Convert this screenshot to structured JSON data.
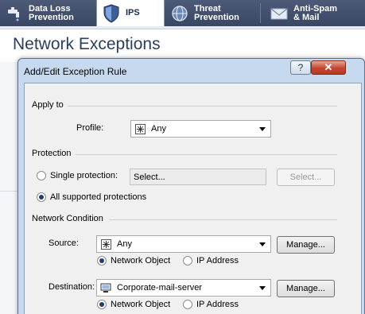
{
  "tabs": [
    {
      "line1": "Data Loss",
      "line2": "Prevention",
      "icon": "faucet-icon",
      "active": false
    },
    {
      "line1": "IPS",
      "line2": "",
      "icon": "shield-icon",
      "active": true
    },
    {
      "line1": "Threat",
      "line2": "Prevention",
      "icon": "globe-icon",
      "active": false
    },
    {
      "line1": "Anti-Spam",
      "line2": "& Mail",
      "icon": "envelope-icon",
      "active": false
    }
  ],
  "page": {
    "title": "Network Exceptions"
  },
  "dialog": {
    "title": "Add/Edit Exception Rule",
    "help_label": "?",
    "close_label": "✕",
    "apply_to": {
      "section_label": "Apply to",
      "profile_label": "Profile:",
      "profile_value": "Any"
    },
    "protection": {
      "section_label": "Protection",
      "single_label": "Single protection:",
      "single_value": "Select...",
      "select_button": "Select...",
      "all_label": "All supported protections",
      "selected": "all"
    },
    "network_condition": {
      "section_label": "Network Condition",
      "source_label": "Source:",
      "source_value": "Any",
      "source_manage": "Manage...",
      "source_radio_object": "Network Object",
      "source_radio_ip": "IP Address",
      "destination_label": "Destination:",
      "destination_value": "Corporate-mail-server",
      "destination_manage": "Manage...",
      "destination_radio_object": "Network Object",
      "destination_radio_ip": "IP Address"
    }
  },
  "colors": {
    "tab_bar": "#3f4c6a",
    "dialog_frame": "#c7d9ee",
    "close_button": "#c4462e",
    "title_text": "#2c3e5c"
  }
}
